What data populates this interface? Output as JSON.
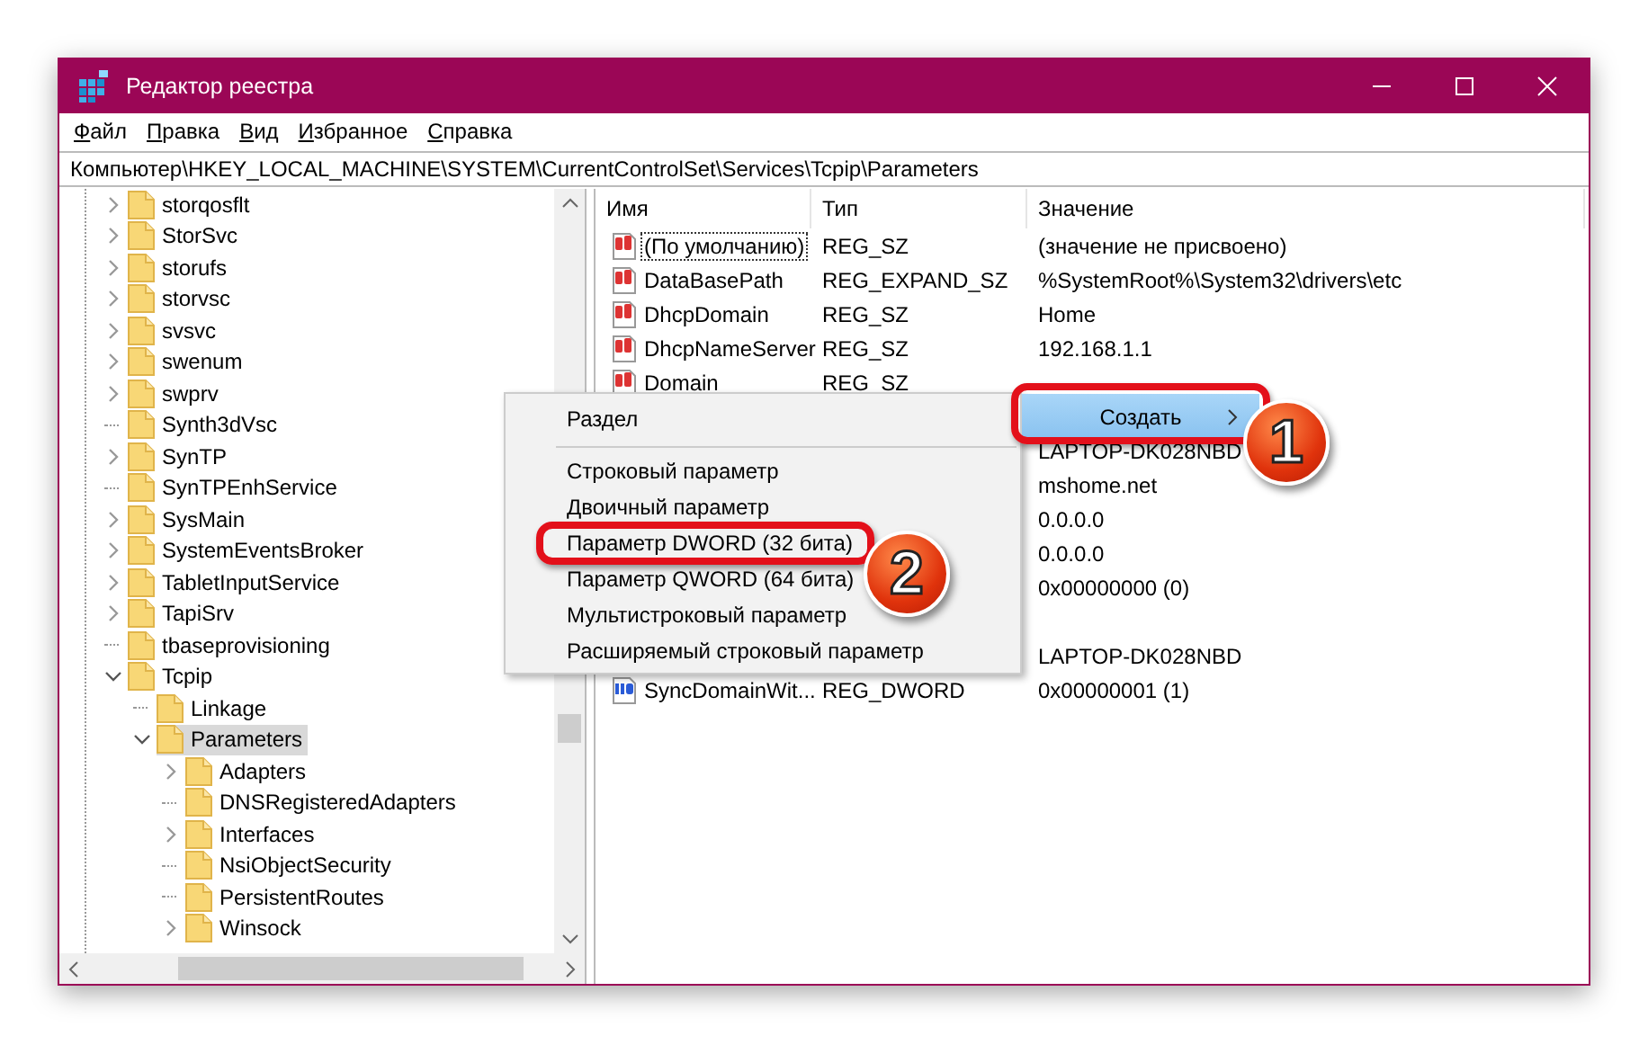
{
  "window": {
    "title": "Редактор реестра"
  },
  "menu": [
    "Файл",
    "Правка",
    "Вид",
    "Избранное",
    "Справка"
  ],
  "address": "Компьютер\\HKEY_LOCAL_MACHINE\\SYSTEM\\CurrentControlSet\\Services\\Tcpip\\Parameters",
  "tree": {
    "items": [
      {
        "label": "storqosflt",
        "expanded": false,
        "selected": false
      },
      {
        "label": "StorSvc",
        "expanded": false,
        "selected": false
      },
      {
        "label": "storufs",
        "expanded": false,
        "selected": false
      },
      {
        "label": "storvsc",
        "expanded": false,
        "selected": false
      },
      {
        "label": "svsvc",
        "expanded": false,
        "selected": false
      },
      {
        "label": "swenum",
        "expanded": false,
        "selected": false
      },
      {
        "label": "swprv",
        "expanded": false,
        "selected": false
      },
      {
        "label": "Synth3dVsc",
        "selected": false
      },
      {
        "label": "SynTP",
        "expanded": false,
        "selected": false
      },
      {
        "label": "SynTPEnhService",
        "selected": false
      },
      {
        "label": "SysMain",
        "expanded": false,
        "selected": false
      },
      {
        "label": "SystemEventsBroker",
        "expanded": false,
        "selected": false
      },
      {
        "label": "TabletInputService",
        "expanded": false,
        "selected": false
      },
      {
        "label": "TapiSrv",
        "expanded": false,
        "selected": false
      },
      {
        "label": "tbaseprovisioning",
        "selected": false
      },
      {
        "label": "Tcpip",
        "expanded": true,
        "selected": false,
        "children": [
          {
            "label": "Linkage",
            "selected": false
          },
          {
            "label": "Parameters",
            "expanded": true,
            "selected": true,
            "children": [
              {
                "label": "Adapters",
                "expanded": false,
                "selected": false
              },
              {
                "label": "DNSRegisteredAdapters",
                "selected": false
              },
              {
                "label": "Interfaces",
                "expanded": false,
                "selected": false
              },
              {
                "label": "NsiObjectSecurity",
                "selected": false
              },
              {
                "label": "PersistentRoutes",
                "selected": false
              },
              {
                "label": "Winsock",
                "expanded": false,
                "selected": false
              }
            ]
          }
        ]
      }
    ]
  },
  "list": {
    "columns": [
      "Имя",
      "Тип",
      "Значение"
    ],
    "rows": [
      {
        "kind": "string",
        "name": "(По умолчанию)",
        "type": "REG_SZ",
        "value": "(значение не присвоено)",
        "focused": true
      },
      {
        "kind": "string",
        "name": "DataBasePath",
        "type": "REG_EXPAND_SZ",
        "value": "%SystemRoot%\\System32\\drivers\\etc",
        "focused": false
      },
      {
        "kind": "string",
        "name": "DhcpDomain",
        "type": "REG_SZ",
        "value": "Home",
        "focused": false
      },
      {
        "kind": "string",
        "name": "DhcpNameServer",
        "type": "REG_SZ",
        "value": "192.168.1.1",
        "focused": false
      },
      {
        "kind": "string",
        "name": "Domain",
        "type": "REG_SZ",
        "focused": false
      },
      {},
      {
        "value": "LAPTOP-DK028NBD"
      },
      {
        "value": "mshome.net"
      },
      {
        "value": "0.0.0.0"
      },
      {
        "value": "0.0.0.0"
      },
      {
        "value": "0x00000000 (0)"
      },
      {},
      {
        "value": "LAPTOP-DK028NBD"
      },
      {
        "kind": "binary",
        "name": "SyncDomainWit...",
        "type": "REG_DWORD",
        "value": "0x00000001 (1)",
        "focused": false
      }
    ]
  },
  "context_menu": {
    "items": [
      {
        "kind": "item",
        "label": "Раздел"
      },
      {
        "kind": "separator"
      },
      {
        "kind": "item",
        "label": "Строковый параметр"
      },
      {
        "kind": "item",
        "label": "Двоичный параметр"
      },
      {
        "kind": "item",
        "label": "Параметр DWORD (32 бита)"
      },
      {
        "kind": "item",
        "label": "Параметр QWORD (64 бита)"
      },
      {
        "kind": "item",
        "label": "Мультистроковый параметр"
      },
      {
        "kind": "item",
        "label": "Расширяемый строковый параметр"
      }
    ]
  },
  "parent_menu_item": {
    "label": "Создать",
    "selected": true
  },
  "callouts": [
    {
      "number": "1"
    },
    {
      "number": "2"
    }
  ]
}
